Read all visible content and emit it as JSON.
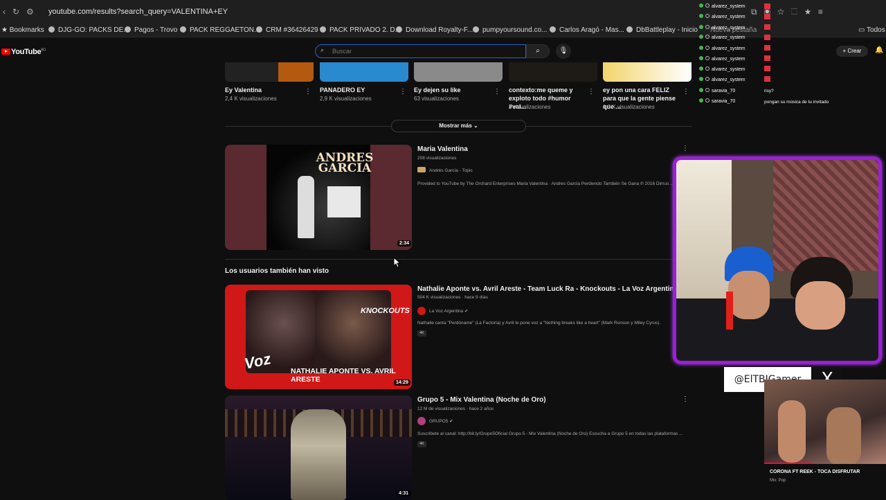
{
  "browser": {
    "url": "youtube.com/results?search_query=VALENTINA+EY",
    "bookmarks": [
      {
        "label": "Bookmarks"
      },
      {
        "label": "DJG-GO: PACKS DE..."
      },
      {
        "label": "Pagos - Trovo"
      },
      {
        "label": "PACK REGGAETON..."
      },
      {
        "label": "CRM #36426429"
      },
      {
        "label": "PACK PRIVADO 2. D..."
      },
      {
        "label": "Download Royalty-F..."
      },
      {
        "label": "pumpyoursound.co..."
      },
      {
        "label": "Carlos Aragó - Mas..."
      },
      {
        "label": "DbBattleplay - Inicio"
      },
      {
        "label": "Nueva pestaña"
      },
      {
        "label": "Todos"
      }
    ]
  },
  "youtube": {
    "logo_text": "YouTube",
    "logo_region": "BO",
    "search_placeholder": "Buscar",
    "create_label": "Crear",
    "shorts": [
      {
        "title": "Ey Valentina",
        "views": "2,4 K visualizaciones",
        "color": "#7a4a1a"
      },
      {
        "title": "PANADERO EY",
        "views": "2,9 K visualizaciones",
        "color": "#3aa0e0"
      },
      {
        "title": "Ey dejen su like",
        "views": "63 visualizaciones",
        "color": "#9a9a9a"
      },
      {
        "title": "contexto:me queme y exploto todo #humor #val...",
        "views": "7 visualizaciones",
        "color": "#2a2520"
      },
      {
        "title": "ey pon una cara FELIZ para que la gente piense que ...",
        "views": "1,3 K visualizaciones",
        "color": "#e8d060"
      }
    ],
    "show_more": "Mostrar más",
    "videos": [
      {
        "title": "Maria Valentina",
        "meta": "208 visualizaciones",
        "channel": "Andrés García - Topic",
        "description": "Provided to YouTube by The Orchard Enterprises Maria Valentina · Andres Garcia Perdiendo También Se Gana ℗ 2016 Dimus ...",
        "duration": "2:34",
        "thumb_text": "ANDRES GARCIA"
      },
      {
        "title": "Nathalie Aponte vs. Avril Areste - Team Luck Ra - Knockouts - La Voz Argentina 2025",
        "meta": "504 K visualizaciones · hace 9 días",
        "channel": "La Voz Argentina",
        "description": "Nathalie canta \"Perdóname\" (La Factoría) y Avril le pone voz a \"Nothing breaks like a heart\" (Mark Ronson y Miley Cyrus).",
        "badge": "4K",
        "duration": "14:29",
        "thumb_text": "NATHALIE APONTE VS. AVRIL ARESTE",
        "thumb_tag": "KNOCKOUTS",
        "thumb_logo": "Voz"
      },
      {
        "title": "Grupo 5 - Mix Valentina (Noche de Oro)",
        "meta": "12 M de visualizaciones · hace 2 años",
        "channel": "GRUPO5",
        "description": "Suscríbete al canal: http://bit.ly/Grupo5Oficial Grupo 5 - Mix Valentina (Noche de Oro) Escucha a Grupo 5 en todas las plataformas ...",
        "badge": "4K",
        "duration": "4:31"
      }
    ],
    "section_heading": "Los usuarios también han visto"
  },
  "chat": {
    "lines": [
      {
        "user": "alvarez_system",
        "type": "g"
      },
      {
        "user": "alvarez_system",
        "type": "g"
      },
      {
        "user": "alvarez_system",
        "type": "g"
      },
      {
        "user": "alvarez_system",
        "type": "g"
      },
      {
        "user": "alvarez_system",
        "type": "g"
      },
      {
        "user": "alvarez_system",
        "type": "g"
      },
      {
        "user": "alvarez_system",
        "type": "g"
      },
      {
        "user": "alvarez_system",
        "type": "g"
      },
      {
        "user": "saravia_70",
        "type": "p"
      },
      {
        "user": "saravia_70",
        "type": "p"
      }
    ],
    "msg1": "risy?",
    "msg2": "pongan su música de tu invitado"
  },
  "overlay": {
    "handle": "@ElTBIGamer",
    "x_glyph": "X",
    "now_playing_title": "CORONA FT REEK - TOCA DISFRUTAR",
    "now_playing_sub": "Mix: Pop",
    "now_playing_progress": 0.4
  }
}
